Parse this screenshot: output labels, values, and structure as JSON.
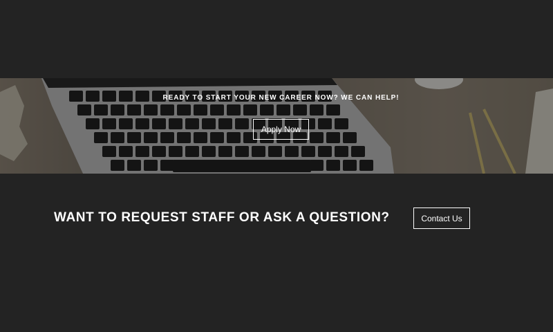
{
  "hero": {
    "tagline": "READY TO START YOUR NEW CAREER NOW? WE CAN HELP!",
    "apply_label": "Apply Now"
  },
  "cta": {
    "heading": "WANT TO REQUEST STAFF OR ASK A QUESTION?",
    "contact_label": "Contact Us"
  },
  "colors": {
    "page_background": "#232323",
    "text": "#ffffff",
    "button_border": "#ffffff"
  }
}
